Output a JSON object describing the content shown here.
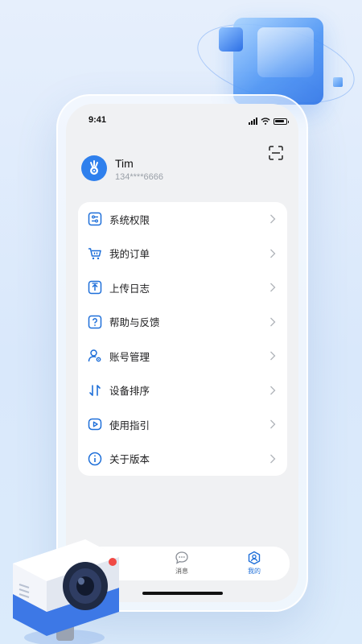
{
  "status_bar": {
    "time": "9:41"
  },
  "profile": {
    "name": "Tim",
    "phone": "134****6666"
  },
  "menu": [
    {
      "label": "系统权限",
      "icon": "sliders-icon"
    },
    {
      "label": "我的订单",
      "icon": "cart-icon"
    },
    {
      "label": "上传日志",
      "icon": "upload-icon"
    },
    {
      "label": "帮助与反馈",
      "icon": "help-icon"
    },
    {
      "label": "账号管理",
      "icon": "user-gear-icon"
    },
    {
      "label": "设备排序",
      "icon": "sort-icon"
    },
    {
      "label": "使用指引",
      "icon": "play-guide-icon"
    },
    {
      "label": "关于版本",
      "icon": "info-icon"
    }
  ],
  "tabbar": {
    "tabs": [
      {
        "label": "消息",
        "icon": "message-icon"
      },
      {
        "label": "我的",
        "icon": "profile-icon",
        "active": true
      }
    ]
  },
  "colors": {
    "accent": "#2f80ed",
    "text": "#1d1d1f",
    "muted": "#9aa0a8",
    "screen_bg": "#f0f1f3"
  }
}
